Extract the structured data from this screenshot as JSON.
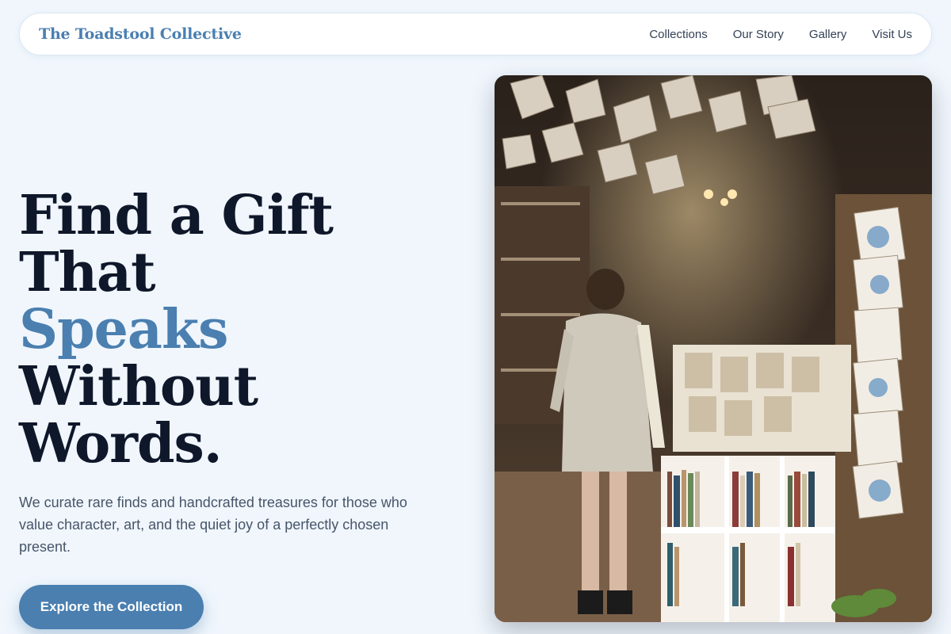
{
  "header": {
    "brand": "The Toadstool Collective",
    "nav": [
      {
        "label": "Collections"
      },
      {
        "label": "Our Story"
      },
      {
        "label": "Gallery"
      },
      {
        "label": "Visit Us"
      }
    ]
  },
  "hero": {
    "headline_line1": "Find a Gift That",
    "headline_accent": "Speaks",
    "headline_line2_rest": " Without",
    "headline_line3": "Words.",
    "subtext": "We curate rare finds and handcrafted treasures for those who value character, art, and the quiet joy of a perfectly chosen present.",
    "cta_label": "Explore the Collection"
  },
  "image": {
    "subject": "bookshop-interior-photo"
  },
  "colors": {
    "accent": "#4a7fb0",
    "headline": "#0f172a",
    "background": "#f0f6fc"
  }
}
